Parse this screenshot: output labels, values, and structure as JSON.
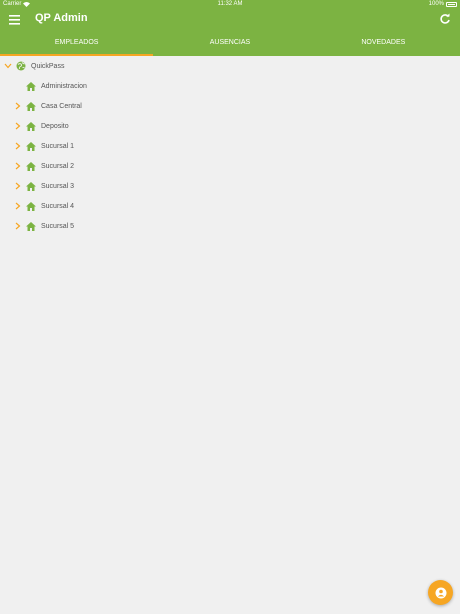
{
  "status_bar": {
    "carrier": "Carrier",
    "time": "11:32 AM",
    "battery": "100%"
  },
  "app": {
    "title": "QP Admin",
    "accent": "#7cb342",
    "tab_indicator": "#f6a623",
    "fab_color": "#f6a623"
  },
  "tabs": [
    {
      "label": "EMPLEADOS",
      "active": true
    },
    {
      "label": "AUSENCIAS",
      "active": false
    },
    {
      "label": "NOVEDADES",
      "active": false
    }
  ],
  "tree": {
    "root": {
      "label": "QuickPass",
      "icon": "globe-icon",
      "expanded": true
    },
    "children": [
      {
        "label": "Administracion",
        "icon": "home-icon",
        "expandable": false
      },
      {
        "label": "Casa Central",
        "icon": "home-icon",
        "expandable": true
      },
      {
        "label": "Deposito",
        "icon": "home-icon",
        "expandable": true
      },
      {
        "label": "Sucursal 1",
        "icon": "home-icon",
        "expandable": true
      },
      {
        "label": "Sucursal 2",
        "icon": "home-icon",
        "expandable": true
      },
      {
        "label": "Sucursal 3",
        "icon": "home-icon",
        "expandable": true
      },
      {
        "label": "Sucursal 4",
        "icon": "home-icon",
        "expandable": true
      },
      {
        "label": "Sucursal 5",
        "icon": "home-icon",
        "expandable": true
      }
    ]
  },
  "fab": {
    "icon": "user-icon"
  }
}
